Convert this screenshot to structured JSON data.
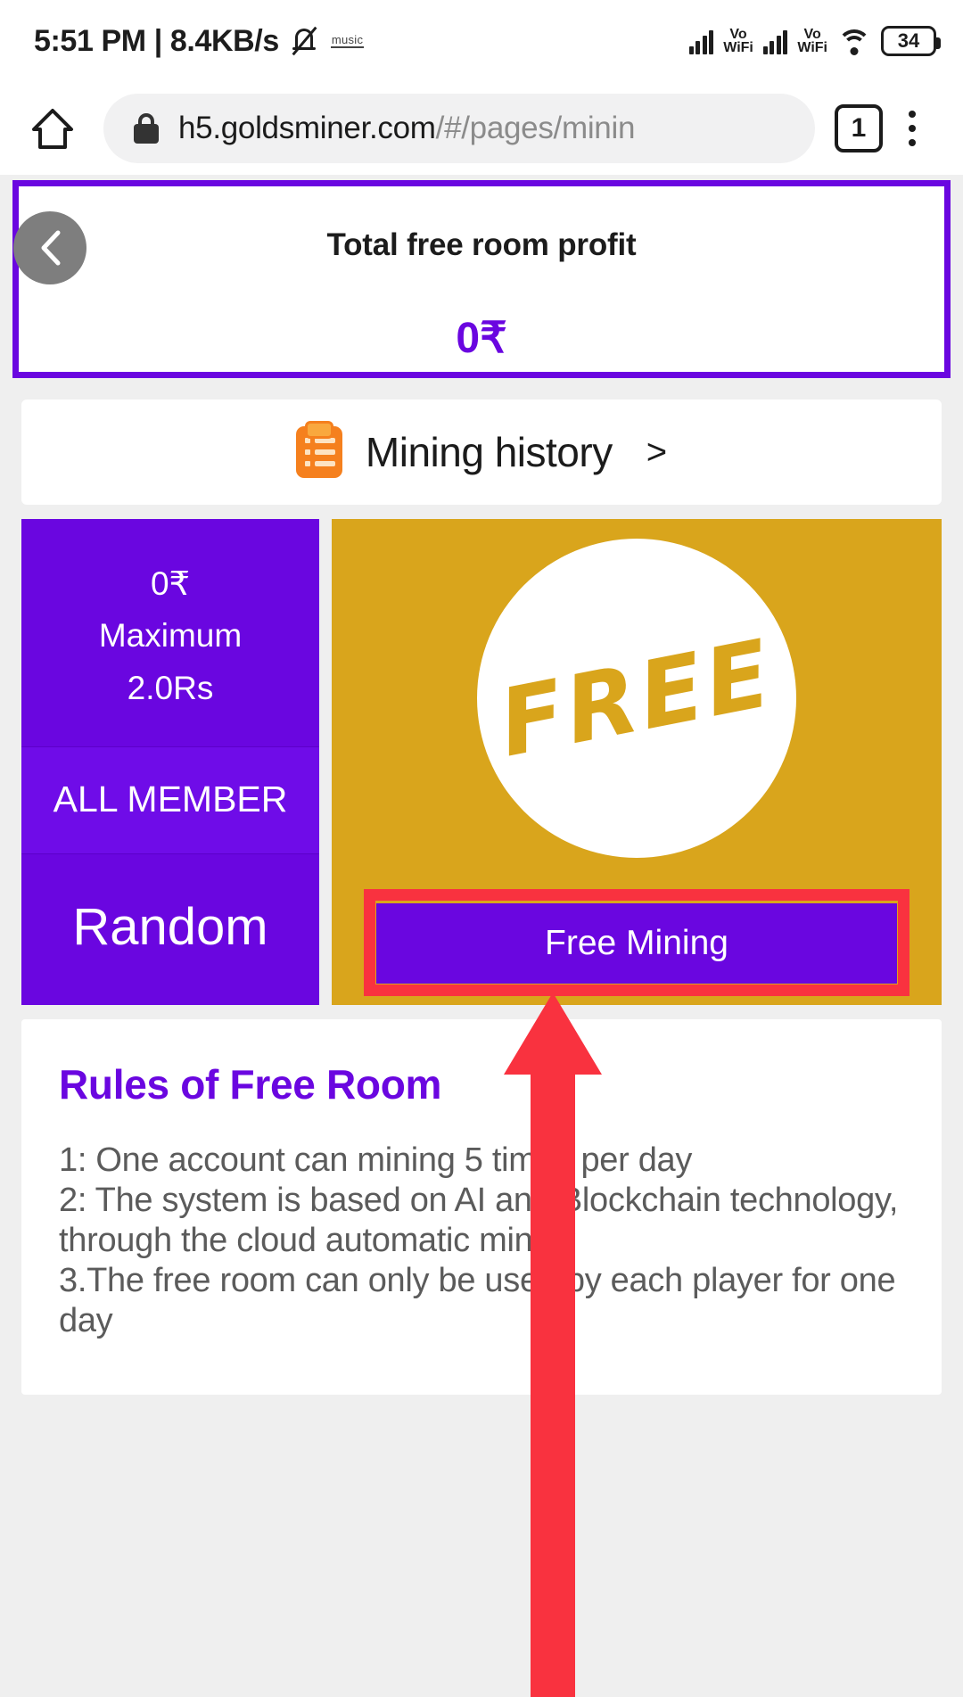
{
  "statusbar": {
    "clock": "5:51 PM | 8.4KB/s",
    "music_label": "music",
    "mute_icon": "bell-mute-icon",
    "signal1_label": "Vo\nWiFi",
    "signal1_line1": "Vo",
    "signal1_line2": "WiFi",
    "signal2_line1": "Vo",
    "signal2_line2": "WiFi",
    "wifi_icon": "wifi-icon",
    "battery_level": "34"
  },
  "browser": {
    "home_icon": "home-icon",
    "lock_icon": "lock-icon",
    "url_domain": "h5.goldsminer.com",
    "url_path": "/#/pages/minin",
    "tab_count": "1",
    "menu_icon": "kebab-menu-icon"
  },
  "hero": {
    "back_icon": "chevron-left-icon",
    "title": "Total free room profit",
    "value": "0₹"
  },
  "history": {
    "icon": "clipboard-list-icon",
    "label": "Mining history",
    "chevron": ">"
  },
  "tiles": {
    "left": {
      "amount": "0₹",
      "maximum_label": "Maximum",
      "maximum_value": "2.0Rs",
      "member_label": "ALL MEMBER",
      "mode_label": "Random"
    },
    "right": {
      "badge_text": "FREE",
      "button_label": "Free Mining",
      "gold_color": "#d9a51c",
      "highlight_color": "#f9323f"
    }
  },
  "rules": {
    "title": "Rules of Free Room",
    "line1": "1: One account can mining 5 times per day",
    "line2": "2: The system is based on AI and Blockchain technology, through the cloud automatic mining",
    "line3": "3.The free room can only be used by each player for one day"
  },
  "annotation": {
    "arrow_color": "#f9323f",
    "arrow_name": "pointing-arrow"
  },
  "colors": {
    "purple": "#6a06e0",
    "gold": "#d9a51c",
    "red": "#f9323f"
  }
}
